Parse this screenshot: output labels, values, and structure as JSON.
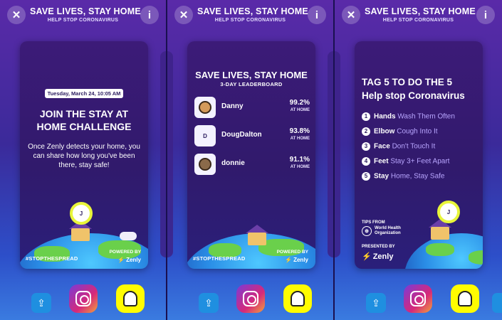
{
  "header": {
    "title": "SAVE LIVES, STAY HOME",
    "subtitle": "HELP STOP CORONAVIRUS"
  },
  "icons": {
    "close": "✕",
    "info": "i",
    "upload": "⇪",
    "zenly_bolt": "⚡"
  },
  "panel1": {
    "date": "Tuesday, March 24, 10:05 AM",
    "title": "JOIN THE STAY AT HOME CHALLENGE",
    "body": "Once Zenly detects your home, you can share how long you've been there, stay safe!",
    "pin_letter": "J",
    "hashtag": "#STOPTHESPREAD",
    "powered_by": "POWERED BY",
    "brand": "Zenly"
  },
  "panel2": {
    "title": "SAVE LIVES, STAY HOME",
    "subtitle": "3-DAY LEADERBOARD",
    "rows": [
      {
        "name": "Danny",
        "pct": "99.2%",
        "pct_label": "AT HOME",
        "avatar": ""
      },
      {
        "name": "DougDalton",
        "pct": "93.8%",
        "pct_label": "AT HOME",
        "avatar": "D"
      },
      {
        "name": "donnie",
        "pct": "91.1%",
        "pct_label": "AT HOME",
        "avatar": ""
      }
    ],
    "hashtag": "#STOPTHESPREAD",
    "powered_by": "POWERED BY",
    "brand": "Zenly"
  },
  "panel3": {
    "title_line1": "TAG 5 TO DO THE 5",
    "title_line2": "Help stop Coronavirus",
    "tips": [
      {
        "num": "1",
        "strong": "Hands",
        "rest": "Wash Them Often"
      },
      {
        "num": "2",
        "strong": "Elbow",
        "rest": "Cough Into It"
      },
      {
        "num": "3",
        "strong": "Face",
        "rest": "Don't Touch It"
      },
      {
        "num": "4",
        "strong": "Feet",
        "rest": "Stay 3+ Feet Apart"
      },
      {
        "num": "5",
        "strong": "Stay",
        "rest": "Home, Stay Safe"
      }
    ],
    "tips_from": "TIPS FROM",
    "who_line1": "World Health",
    "who_line2": "Organization",
    "presented_by": "PRESENTED BY",
    "brand": "Zenly",
    "pin_letter": "J"
  },
  "colors": {
    "accent_yellow": "#fffc00",
    "ring_yellow": "#e8f53a",
    "tip_rest": "#b9a6ff"
  }
}
